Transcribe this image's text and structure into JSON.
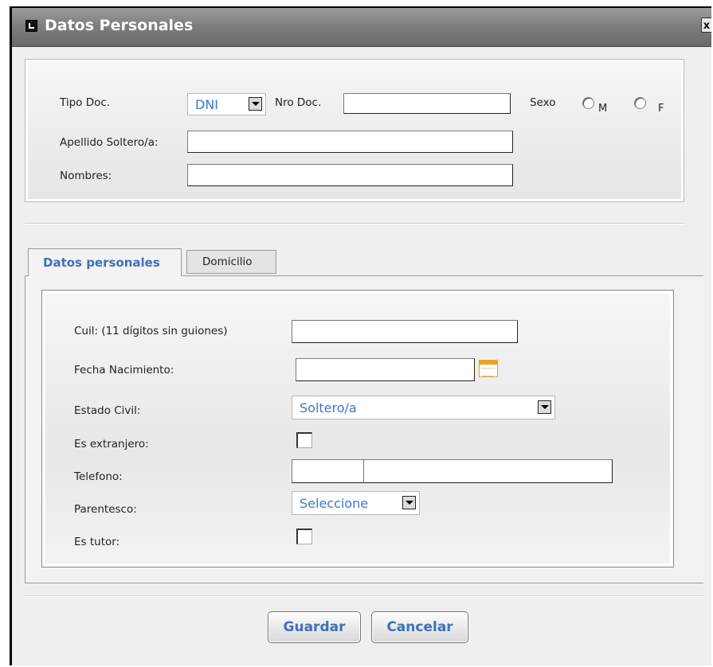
{
  "dialog": {
    "title": "Datos Personales",
    "close_glyph": "x"
  },
  "identity": {
    "tipo_doc_label": "Tipo Doc.",
    "tipo_doc_value": "DNI",
    "nro_doc_label": "Nro Doc.",
    "nro_doc_value": "",
    "sexo_label": "Sexo",
    "sexo_options": [
      "M",
      "F"
    ],
    "apellido_label": "Apellido Soltero/a:",
    "apellido_value": "",
    "nombres_label": "Nombres:",
    "nombres_value": ""
  },
  "tabs": [
    {
      "label": "Datos personales",
      "active": true
    },
    {
      "label": "Domicilio",
      "active": false
    }
  ],
  "personal": {
    "cuil_label": "Cuil: (11 dígitos sin guiones)",
    "cuil_value": "",
    "fecha_label": "Fecha Nacimiento:",
    "fecha_value": "",
    "estado_label": "Estado Civil:",
    "estado_value": "Soltero/a",
    "extranjero_label": "Es extranjero:",
    "telefono_label": "Telefono:",
    "telefono_area": "",
    "telefono_numero": "",
    "parentesco_label": "Parentesco:",
    "parentesco_value": "Seleccione",
    "tutor_label": "Es tutor:"
  },
  "actions": {
    "save_label": "Guardar",
    "cancel_label": "Cancelar"
  },
  "colors": {
    "accent": "#3d72b8",
    "titlebar": "#7e7e7e"
  }
}
